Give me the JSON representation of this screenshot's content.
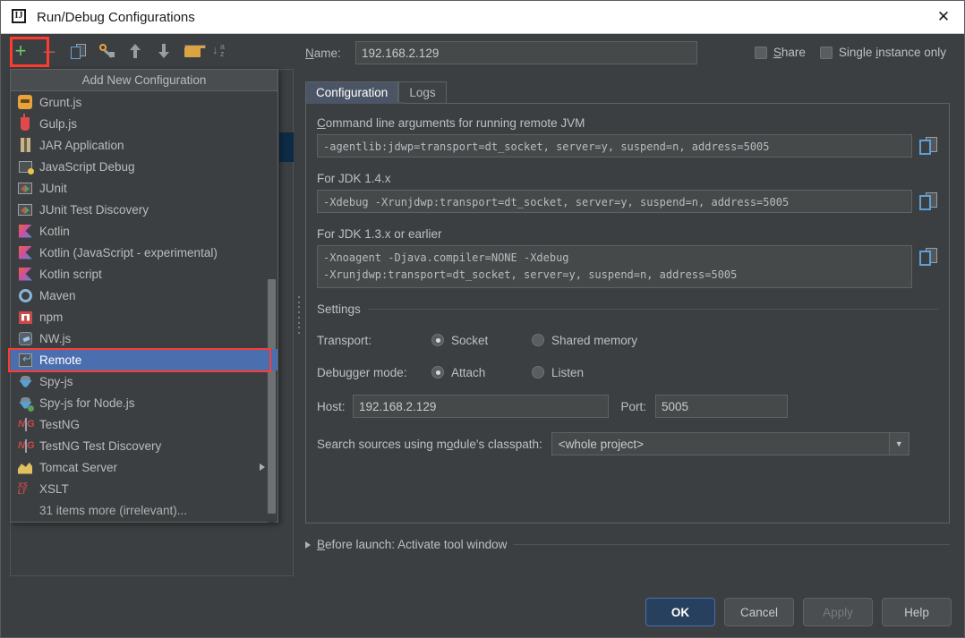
{
  "window": {
    "title": "Run/Debug Configurations",
    "app_icon": "intellij-idea-icon",
    "close_icon": "✕"
  },
  "toolbar": {
    "items": [
      {
        "name": "add-configuration",
        "icon": "plus-icon",
        "label": "+"
      },
      {
        "name": "remove-configuration",
        "icon": "minus-icon",
        "label": "–"
      },
      {
        "name": "copy-configuration",
        "icon": "copy-icon",
        "label": ""
      },
      {
        "name": "edit-templates",
        "icon": "wrench-icon",
        "label": ""
      },
      {
        "name": "move-up",
        "icon": "arrow-up-icon",
        "label": ""
      },
      {
        "name": "move-down",
        "icon": "arrow-down-icon",
        "label": ""
      },
      {
        "name": "create-folder",
        "icon": "folder-icon",
        "label": ""
      },
      {
        "name": "sort-configurations",
        "icon": "sort-az-icon",
        "label": ""
      }
    ]
  },
  "popup": {
    "header": "Add New Configuration",
    "items": [
      {
        "label": "Grunt.js",
        "icon": "grunt-icon",
        "selected": false,
        "submenu": false
      },
      {
        "label": "Gulp.js",
        "icon": "gulp-icon",
        "selected": false,
        "submenu": false
      },
      {
        "label": "JAR Application",
        "icon": "jar-icon",
        "selected": false,
        "submenu": false
      },
      {
        "label": "JavaScript Debug",
        "icon": "javascript-debug-icon",
        "selected": false,
        "submenu": false
      },
      {
        "label": "JUnit",
        "icon": "junit-icon",
        "selected": false,
        "submenu": false
      },
      {
        "label": "JUnit Test Discovery",
        "icon": "junit-icon",
        "selected": false,
        "submenu": false
      },
      {
        "label": "Kotlin",
        "icon": "kotlin-icon",
        "selected": false,
        "submenu": false
      },
      {
        "label": "Kotlin (JavaScript - experimental)",
        "icon": "kotlin-icon",
        "selected": false,
        "submenu": false
      },
      {
        "label": "Kotlin script",
        "icon": "kotlin-icon",
        "selected": false,
        "submenu": false
      },
      {
        "label": "Maven",
        "icon": "maven-icon",
        "selected": false,
        "submenu": false
      },
      {
        "label": "npm",
        "icon": "npm-icon",
        "selected": false,
        "submenu": false
      },
      {
        "label": "NW.js",
        "icon": "nwjs-icon",
        "selected": false,
        "submenu": false
      },
      {
        "label": "Remote",
        "icon": "remote-icon",
        "selected": true,
        "submenu": false
      },
      {
        "label": "Spy-js",
        "icon": "spyjs-icon",
        "selected": false,
        "submenu": false
      },
      {
        "label": "Spy-js for Node.js",
        "icon": "spyjs-node-icon",
        "selected": false,
        "submenu": false
      },
      {
        "label": "TestNG",
        "icon": "testng-icon",
        "selected": false,
        "submenu": false
      },
      {
        "label": "TestNG Test Discovery",
        "icon": "testng-icon",
        "selected": false,
        "submenu": false
      },
      {
        "label": "Tomcat Server",
        "icon": "tomcat-icon",
        "selected": false,
        "submenu": true
      },
      {
        "label": "XSLT",
        "icon": "xslt-icon",
        "selected": false,
        "submenu": false
      }
    ],
    "more_label": "31 items more (irrelevant)..."
  },
  "name_field": {
    "label": "Name:",
    "value": "192.168.2.129",
    "placeholder": ""
  },
  "options": {
    "share_label": "Share",
    "share_checked": false,
    "single_instance_label": "Single instance only",
    "single_instance_checked": false
  },
  "tabs": [
    {
      "label": "Configuration",
      "active": true
    },
    {
      "label": "Logs",
      "active": false
    }
  ],
  "configuration": {
    "cmdline_label": "Command line arguments for running remote JVM",
    "cmdline_value": "-agentlib:jdwp=transport=dt_socket, server=y, suspend=n, address=5005",
    "jdk14_label": "For JDK 1.4.x",
    "jdk14_value": "-Xdebug -Xrunjdwp:transport=dt_socket, server=y, suspend=n, address=5005",
    "jdk13_label": "For JDK 1.3.x or earlier",
    "jdk13_value_line1": "-Xnoagent -Djava.compiler=NONE -Xdebug",
    "jdk13_value_line2": "-Xrunjdwp:transport=dt_socket, server=y, suspend=n, address=5005",
    "settings_label": "Settings",
    "transport_label": "Transport:",
    "transport_options": [
      {
        "label": "Socket",
        "selected": true
      },
      {
        "label": "Shared memory",
        "selected": false
      }
    ],
    "debugger_mode_label": "Debugger mode:",
    "debugger_mode_options": [
      {
        "label": "Attach",
        "selected": true
      },
      {
        "label": "Listen",
        "selected": false
      }
    ],
    "host_label": "Host:",
    "host_value": "192.168.2.129",
    "port_label": "Port:",
    "port_value": "5005",
    "classpath_label": "Search sources using module's classpath:",
    "classpath_value": "<whole project>",
    "copy_icon": "copy-icon"
  },
  "before_launch": {
    "label": "Before launch: Activate tool window",
    "expanded": false
  },
  "footer": {
    "ok": "OK",
    "cancel": "Cancel",
    "apply": "Apply",
    "apply_disabled": true,
    "help": "Help"
  },
  "colors": {
    "background": "#3c3f41",
    "panel": "#45494a",
    "selection": "#4b6eaf",
    "accent_default_button": "#27405e",
    "highlight_red": "#ff3b30",
    "text": "#bcc0c3"
  }
}
